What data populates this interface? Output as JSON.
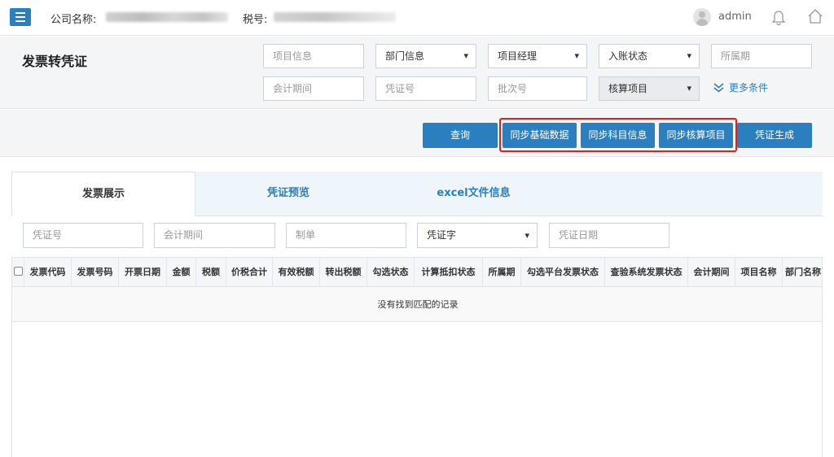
{
  "topbar": {
    "company_label": "公司名称:",
    "tax_label": "税号:",
    "user_name": "admin"
  },
  "page": {
    "title": "发票转凭证"
  },
  "filters": {
    "row1": [
      {
        "text": "项目信息",
        "type": "input"
      },
      {
        "text": "部门信息",
        "type": "select"
      },
      {
        "text": "项目经理",
        "type": "select"
      },
      {
        "text": "入账状态",
        "type": "select"
      },
      {
        "text": "所属期",
        "type": "input"
      }
    ],
    "row2": [
      {
        "text": "会计期间",
        "type": "input"
      },
      {
        "text": "凭证号",
        "type": "input"
      },
      {
        "text": "批次号",
        "type": "input"
      },
      {
        "text": "核算项目",
        "type": "select"
      }
    ],
    "more": "更多条件"
  },
  "actions": {
    "query": "查询",
    "sync_base": "同步基础数据",
    "sync_subject": "同步科目信息",
    "sync_accounting": "同步核算项目",
    "generate": "凭证生成"
  },
  "tabs": [
    {
      "label": "发票展示",
      "active": true
    },
    {
      "label": "凭证预览",
      "active": false
    },
    {
      "label": "excel文件信息",
      "active": false
    }
  ],
  "sub_filters": [
    {
      "text": "凭证号",
      "type": "input"
    },
    {
      "text": "会计期间",
      "type": "input"
    },
    {
      "text": "制单",
      "type": "input"
    },
    {
      "text": "凭证字",
      "type": "select"
    },
    {
      "text": "凭证日期",
      "type": "input"
    }
  ],
  "table": {
    "columns": [
      "发票代码",
      "发票号码",
      "开票日期",
      "金额",
      "税额",
      "价税合计",
      "有效税额",
      "转出税额",
      "勾选状态",
      "计算抵扣状态",
      "所属期",
      "勾选平台发票状态",
      "查验系统发票状态",
      "会计期间",
      "项目名称",
      "部门名称"
    ],
    "empty_message": "没有找到匹配的记录"
  },
  "colors": {
    "primary": "#2c7fbf",
    "highlight": "#e02020",
    "panel": "#f3f5f7"
  }
}
